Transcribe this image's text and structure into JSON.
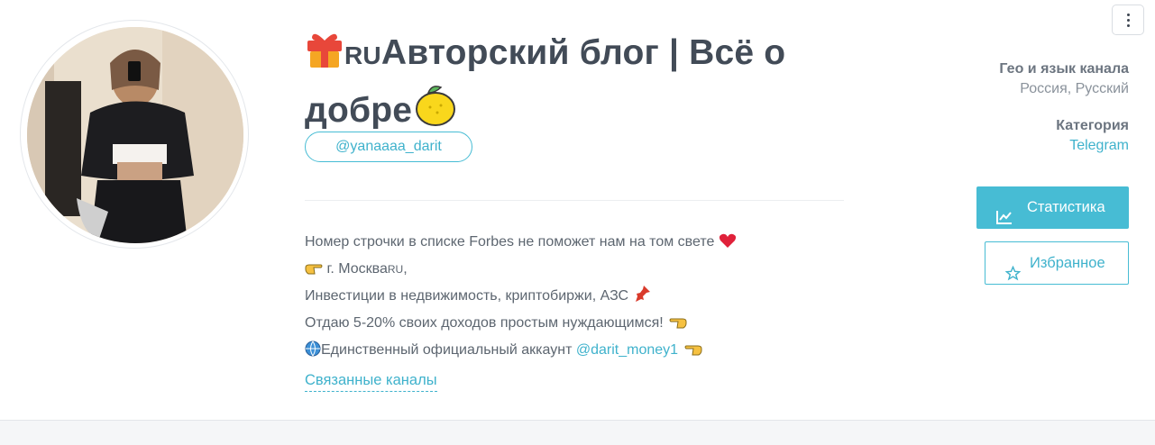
{
  "channel": {
    "title_flag": "RU",
    "title_text": "Авторский блог | Всё о добре",
    "handle": "@yanaaaa_darit"
  },
  "description": {
    "line1": "Номер строчки в списке Forbes не поможет нам на том свете",
    "line2_prefix": " г. Москва",
    "line2_flag": "RU",
    "line2_suffix": ",",
    "line3": "Инвестиции в недвижимость, криптобиржи, АЗС",
    "line4": "Отдаю 5-20% своих доходов простым нуждающимся!",
    "line5": "Единственный официальный аккаунт ",
    "line5_link": "@darit_money1"
  },
  "related_label": "Связанные каналы",
  "sidebar": {
    "geo_title": "Гео и язык канала",
    "geo_value": "Россия, Русский",
    "category_title": "Категория",
    "category_value": "Telegram",
    "stats_button": "Статистика",
    "favorite_button": "Избранное"
  },
  "colors": {
    "accent": "#47bcd4",
    "title": "#424b57",
    "text": "#5d6670"
  },
  "icons": [
    "gift-icon",
    "lemon-icon",
    "heart-icon",
    "pointing-hand-icon",
    "pushpin-icon",
    "globe-icon",
    "chart-line-icon",
    "star-icon",
    "more-vertical-icon"
  ]
}
